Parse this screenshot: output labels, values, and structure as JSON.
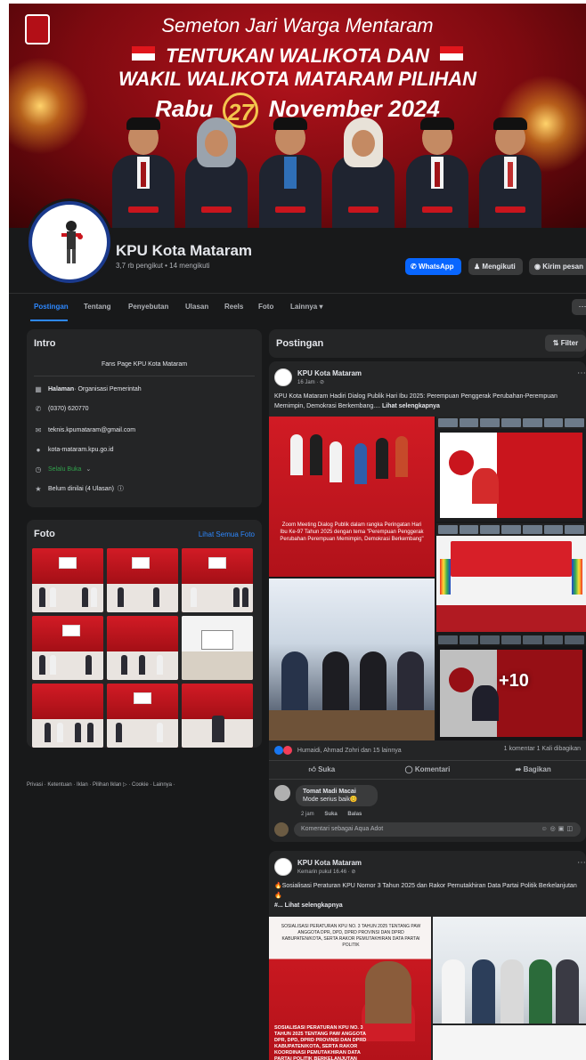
{
  "cover": {
    "tagline": "Semeton Jari Warga Mentaram",
    "headline_1": "TENTUKAN WALIKOTA DAN",
    "headline_2": "WAKIL WALIKOTA MATARAM PILIHAN",
    "date_prefix": "Rabu",
    "date_day": "27",
    "date_suffix": "November 2024",
    "brand_color": "#b3131c"
  },
  "profile": {
    "name": "KPU Kota Mataram",
    "stats": "3,7 rb pengikut • 14 mengikuti",
    "buttons": {
      "whatsapp": "WhatsApp",
      "following": "Mengikuti",
      "message": "Kirim pesan"
    }
  },
  "tabs": {
    "items": [
      "Postingan",
      "Tentang",
      "Penyebutan",
      "Ulasan",
      "Reels",
      "Foto",
      "Lainnya ▾"
    ],
    "more_icon": "⋯",
    "active_color": "#2d88ff"
  },
  "intro": {
    "title": "Intro",
    "description": "Fans Page KPU Kota Mataram",
    "page_type_label": "Halaman",
    "page_type_value": " · Organisasi Pemerintah",
    "phone": "(0370) 620770",
    "email": "teknis.kpumataram@gmail.com",
    "website": "kota-mataram.kpu.go.id",
    "hours": "Selalu Buka",
    "rating": "Belum dinilai (4 Ulasan)"
  },
  "photos": {
    "title": "Foto",
    "see_all": "Lihat Semua Foto"
  },
  "footer": {
    "links": "Privasi · Ketentuan · Iklan · Pilihan Iklan ▷ · Cookie · Lainnya ·"
  },
  "posts_header": {
    "title": "Postingan",
    "filter": "Filter"
  },
  "post1": {
    "author": "KPU Kota Mataram",
    "time": "16 Jam · ⊘",
    "text": "KPU Kota Mataram Hadiri Dialog Publik Hari Ibu 2025: Perempuan Penggerak Perubahan-Perempuan Memimpin, Demokrasi Berkembang.... ",
    "see_more": "Lihat selengkapnya",
    "image_banner": "Zoom Meeting Dialog Publik dalam rangka Peringatan Hari Ibu Ke-97 Tahun 2025 dengan tema \"Perempuan Penggerak Perubahan Perempuan Memimpin, Demokrasi Berkembang\"",
    "more_photos": "+10",
    "reactions": "Humaidi, Ahmad Zohri dan 15 lainnya",
    "counts": "1 komentar   1 Kali dibagikan",
    "actions": [
      "Suka",
      "Komentari",
      "Bagikan"
    ],
    "comment": {
      "author": "Tomat Madi Macai",
      "text": "Mode serius baik😊",
      "time": "2 jam",
      "like": "Suka",
      "reply": "Balas"
    },
    "comment_placeholder": "Komentari sebagai Aqua Adot"
  },
  "post2": {
    "author": "KPU Kota Mataram",
    "time": "Kemarin pukul 16.46 · ⊘",
    "text": "🔥Sosialisasi Peraturan KPU Nomor 3 Tahun 2025 dan Rakor Pemutakhiran Data Partai Politik Berkelanjutan🔥",
    "see_more": "#... Lihat selengkapnya",
    "image_header": "SOSIALISASI PERATURAN KPU NO. 3 TAHUN 2025 TENTANG PAW ANGGOTA DPR, DPD, DPRD PROVINSI DAN DPRD KABUPATEN/KOTA, SERTA RAKOR PEMUTAKHIRAN DATA PARTAI POLITIK",
    "image_caption": "SOSIALISASI PERATURAN KPU NO. 3 TAHUN 2025 TENTANG PAW ANGGOTA DPR, DPD, DPRD PROVINSI DAN DPRD KABUPATEN/KOTA, SERTA RAKOR KOORDINASI PEMUTAKHIRAN DATA PARTAI POLITIK BERKELANJUTAN"
  }
}
